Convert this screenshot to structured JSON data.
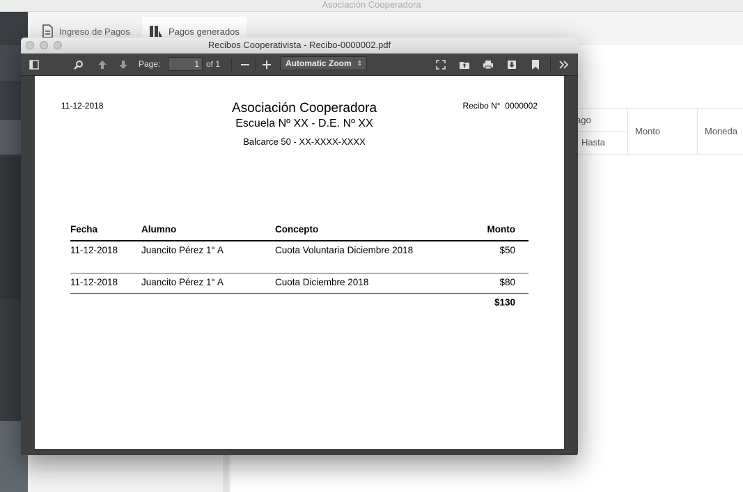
{
  "app": {
    "title": "Asociación Cooperadora",
    "tabs": [
      {
        "label": "Ingreso de Pagos",
        "icon": "document-icon"
      },
      {
        "label": "Pagos generados",
        "icon": "chart-book-icon"
      }
    ],
    "table_headers": {
      "partial_top": "ago",
      "partial_bottom": "Hasta",
      "amount": "Monto",
      "currency": "Moneda"
    }
  },
  "viewer": {
    "title": "Recibos Cooperativista - Recibo-0000002.pdf",
    "page_label": "Page:",
    "page_value": "1",
    "page_of": "of 1",
    "zoom": "Automatic Zoom",
    "zoom_caret": "⇕"
  },
  "receipt": {
    "date": "11-12-2018",
    "org_name": "Asociación Cooperadora",
    "school": "Escuela Nº XX - D.E. Nº XX",
    "address": "Balcarce 50 - XX-XXXX-XXXX",
    "receipt_label": "Recibo N°",
    "receipt_number": "0000002",
    "columns": {
      "date": "Fecha",
      "student": "Alumno",
      "concept": "Concepto",
      "amount": "Monto"
    },
    "rows": [
      {
        "date": "11-12-2018",
        "student": "Juancito Pérez 1° A",
        "concept": "Cuota Voluntaria Diciembre 2018",
        "amount": "$50"
      },
      {
        "date": "11-12-2018",
        "student": "Juancito Pérez 1° A",
        "concept": "Cuota Diciembre 2018",
        "amount": "$80"
      }
    ],
    "total": "$130"
  }
}
